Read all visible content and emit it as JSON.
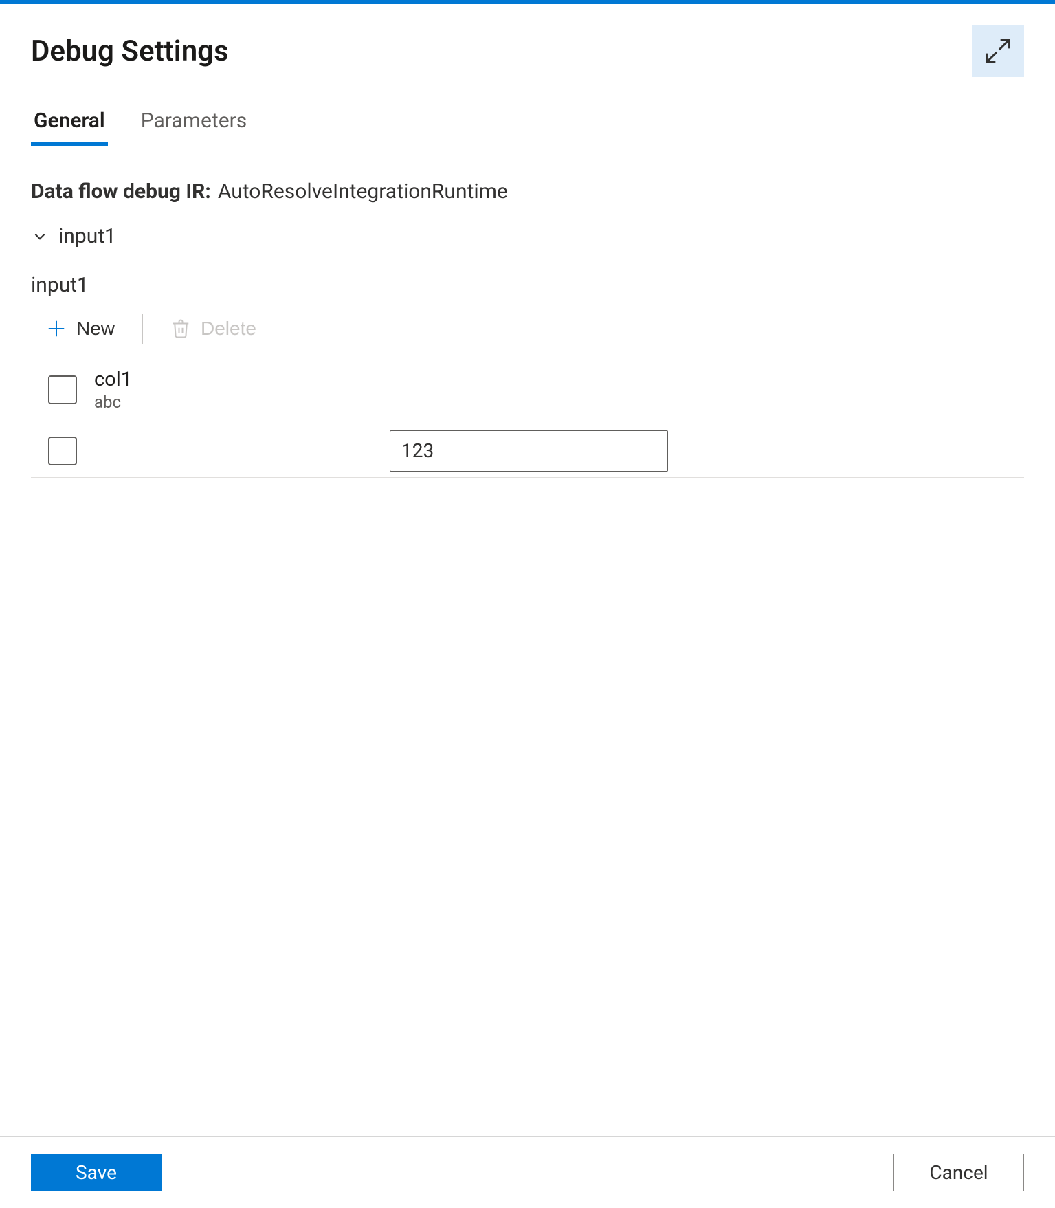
{
  "header": {
    "title": "Debug Settings"
  },
  "tabs": [
    {
      "label": "General",
      "active": true
    },
    {
      "label": "Parameters",
      "active": false
    }
  ],
  "dataflow_ir": {
    "label": "Data flow debug IR:",
    "value": "AutoResolveIntegrationRuntime"
  },
  "input_group": {
    "name": "input1",
    "section_label": "input1"
  },
  "toolbar": {
    "new_label": "New",
    "delete_label": "Delete"
  },
  "table": {
    "header": {
      "column_name": "col1",
      "column_type": "abc"
    },
    "rows": [
      {
        "value": "123"
      }
    ]
  },
  "footer": {
    "save_label": "Save",
    "cancel_label": "Cancel"
  }
}
